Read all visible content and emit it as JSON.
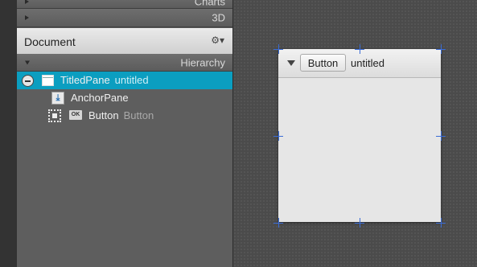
{
  "sections": {
    "charts_label": "Charts",
    "threed_label": "3D",
    "hierarchy_label": "Hierarchy"
  },
  "document": {
    "title": "Document",
    "menu_icon": "gear-icon"
  },
  "hierarchy": {
    "rows": [
      {
        "name": "TitledPane",
        "detail": "untitled"
      },
      {
        "name": "AnchorPane",
        "detail": ""
      },
      {
        "name": "Button",
        "detail": "Button"
      }
    ]
  },
  "preview": {
    "button_label": "Button",
    "pane_title": "untitled"
  },
  "colors": {
    "selection": "#0b9ec0",
    "panel": "#5e5e5e",
    "handle": "#3a6cd6"
  }
}
